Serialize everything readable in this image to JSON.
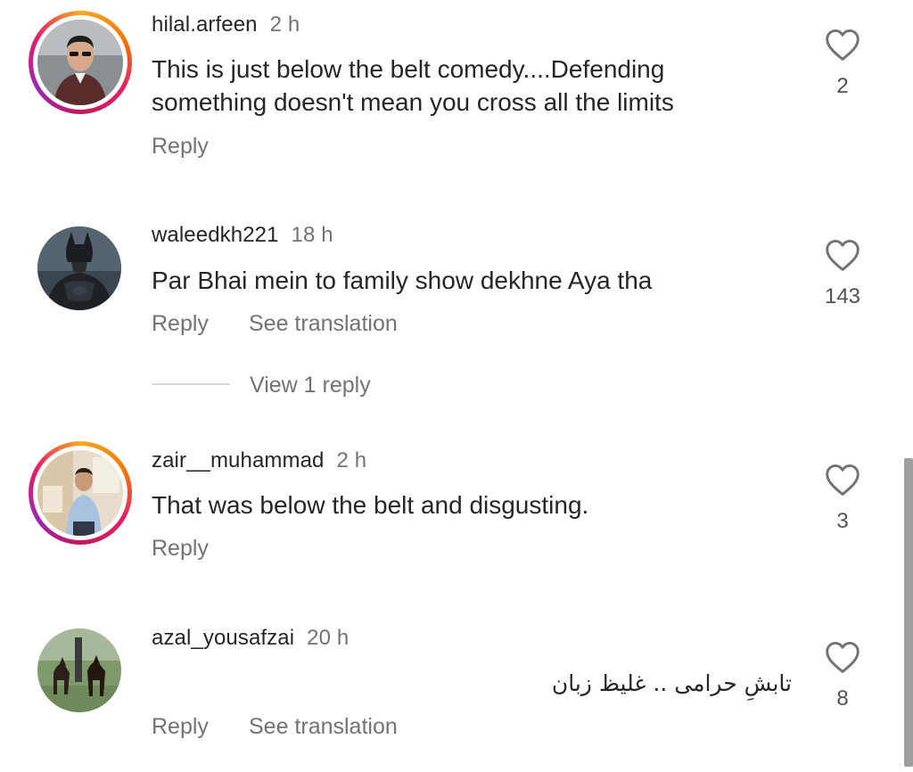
{
  "comments": [
    {
      "username": "hilal.arfeen",
      "time": "2 h",
      "text": "This is just below the belt comedy....Defending something doesn't mean you cross all the limits",
      "reply_label": "Reply",
      "likes": "2",
      "has_story_ring": true,
      "avatar_icon": "profile-photo-man"
    },
    {
      "username": "waleedkh221",
      "time": "18 h",
      "text": "Par Bhai mein to family show dekhne Aya tha",
      "reply_label": "Reply",
      "translate_label": "See translation",
      "view_replies_label": "View 1 reply",
      "likes": "143",
      "has_story_ring": false,
      "avatar_icon": "batman-avatar"
    },
    {
      "username": "zair__muhammad",
      "time": "2 h",
      "text": "That was below the belt and disgusting.",
      "reply_label": "Reply",
      "likes": "3",
      "has_story_ring": true,
      "avatar_icon": "profile-photo-man-indoor"
    },
    {
      "username": "azal_yousafzai",
      "time": "20 h",
      "text": "تابشِ حرامی .. غلیظ زبان",
      "reply_label": "Reply",
      "translate_label": "See translation",
      "likes": "8",
      "has_story_ring": false,
      "avatar_icon": "dogs-photo"
    }
  ],
  "colors": {
    "text_primary": "#262626",
    "text_secondary": "#737373",
    "ring_gradient": [
      "#f9a825",
      "#e91e63",
      "#9c27b0"
    ]
  }
}
